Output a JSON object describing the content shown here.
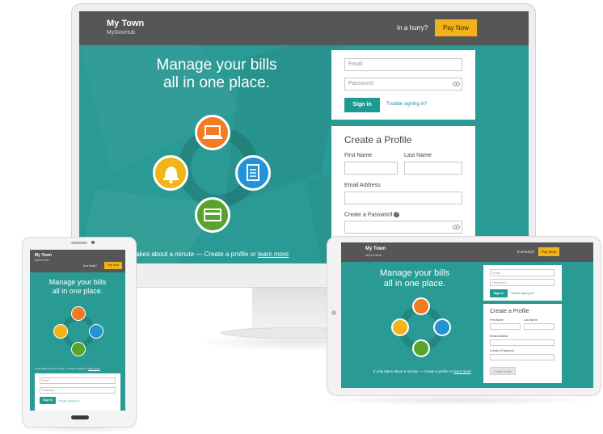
{
  "brand": {
    "title": "My Town",
    "subtitle": "MyGovHub"
  },
  "header": {
    "hurry_text": "In a hurry?",
    "pay_label": "Pay Now"
  },
  "hero": {
    "line1": "Manage your bills",
    "line2": "all in one place."
  },
  "login": {
    "email_placeholder": "Email",
    "password_placeholder": "Password",
    "signin_label": "Sign in",
    "trouble_link": "Trouble signing in?"
  },
  "profile": {
    "title": "Create a Profile",
    "first_name_label": "First Name",
    "last_name_label": "Last Name",
    "email_label": "Email Address",
    "password_label": "Create a Password",
    "button_label": "Create Profile"
  },
  "footer": {
    "desktop_text": "ly takes about a minute — Create a profile or",
    "text": "It only takes about a minute — Create a profile or",
    "learn_more": "learn more"
  },
  "icons": [
    "laptop-icon",
    "document-icon",
    "bell-icon",
    "credit-card-icon",
    "eye-icon",
    "help-icon"
  ],
  "colors": {
    "teal": "#2a9a94",
    "header": "#565656",
    "pay_button": "#f3b21a",
    "orange": "#f37b22",
    "blue": "#2293d8",
    "yellow": "#f2b418",
    "green": "#58a32c"
  }
}
